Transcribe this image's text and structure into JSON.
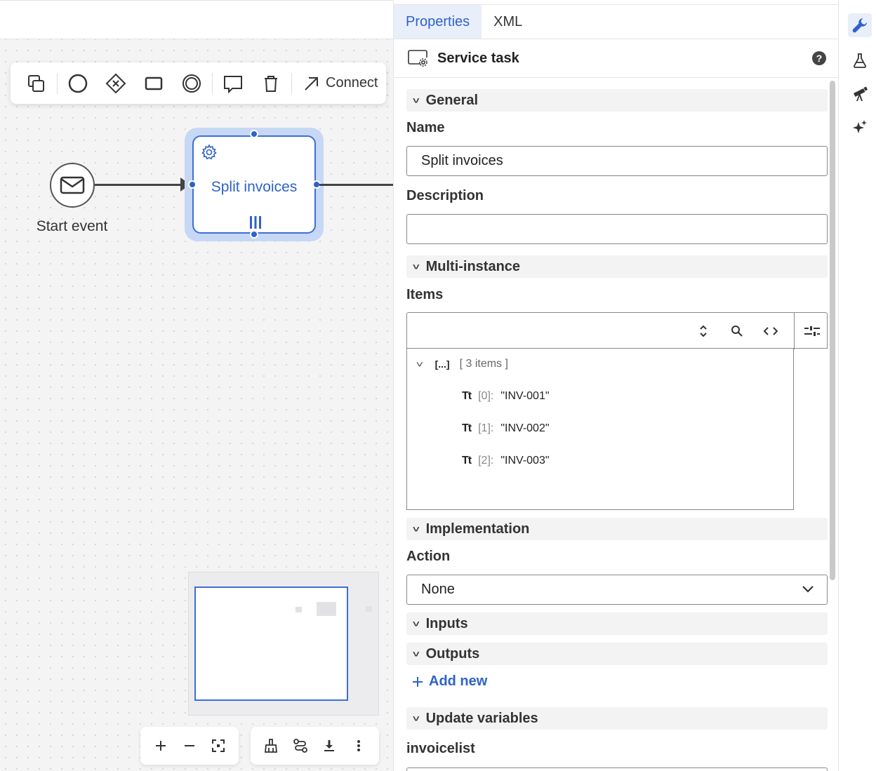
{
  "toolbar": {
    "connect_label": "Connect",
    "tools": [
      "lasso-icon",
      "circle-icon",
      "gateway-icon",
      "rectangle-icon",
      "double-circle-icon",
      "annotation-icon",
      "trash-icon"
    ]
  },
  "diagram": {
    "start_event_label": "Start event",
    "task_label": "Split invoices"
  },
  "panel": {
    "tabs": [
      {
        "label": "Properties",
        "active": true
      },
      {
        "label": "XML",
        "active": false
      }
    ],
    "title": "Service task",
    "help": "?",
    "sections": {
      "general": "General",
      "multi_instance": "Multi-instance",
      "implementation": "Implementation",
      "inputs": "Inputs",
      "outputs": "Outputs",
      "update_variables": "Update variables"
    },
    "fields": {
      "name_label": "Name",
      "name_value": "Split invoices",
      "description_label": "Description",
      "description_value": "",
      "items_label": "Items",
      "action_label": "Action",
      "action_value": "None",
      "invoicelist_label": "invoicelist"
    },
    "items_tree": {
      "root_symbol": "[...]",
      "root_summary": "[ 3 items ]",
      "entries": [
        {
          "type": "Tt",
          "index": "[0]:",
          "value": "\"INV-001\""
        },
        {
          "type": "Tt",
          "index": "[1]:",
          "value": "\"INV-002\""
        },
        {
          "type": "Tt",
          "index": "[2]:",
          "value": "\"INV-003\""
        }
      ]
    },
    "add_new_label": "Add new"
  },
  "colors": {
    "accent": "#2f62c9",
    "selection_halo": "#c6d8f5",
    "canvas_bg": "#f4f4f5"
  }
}
